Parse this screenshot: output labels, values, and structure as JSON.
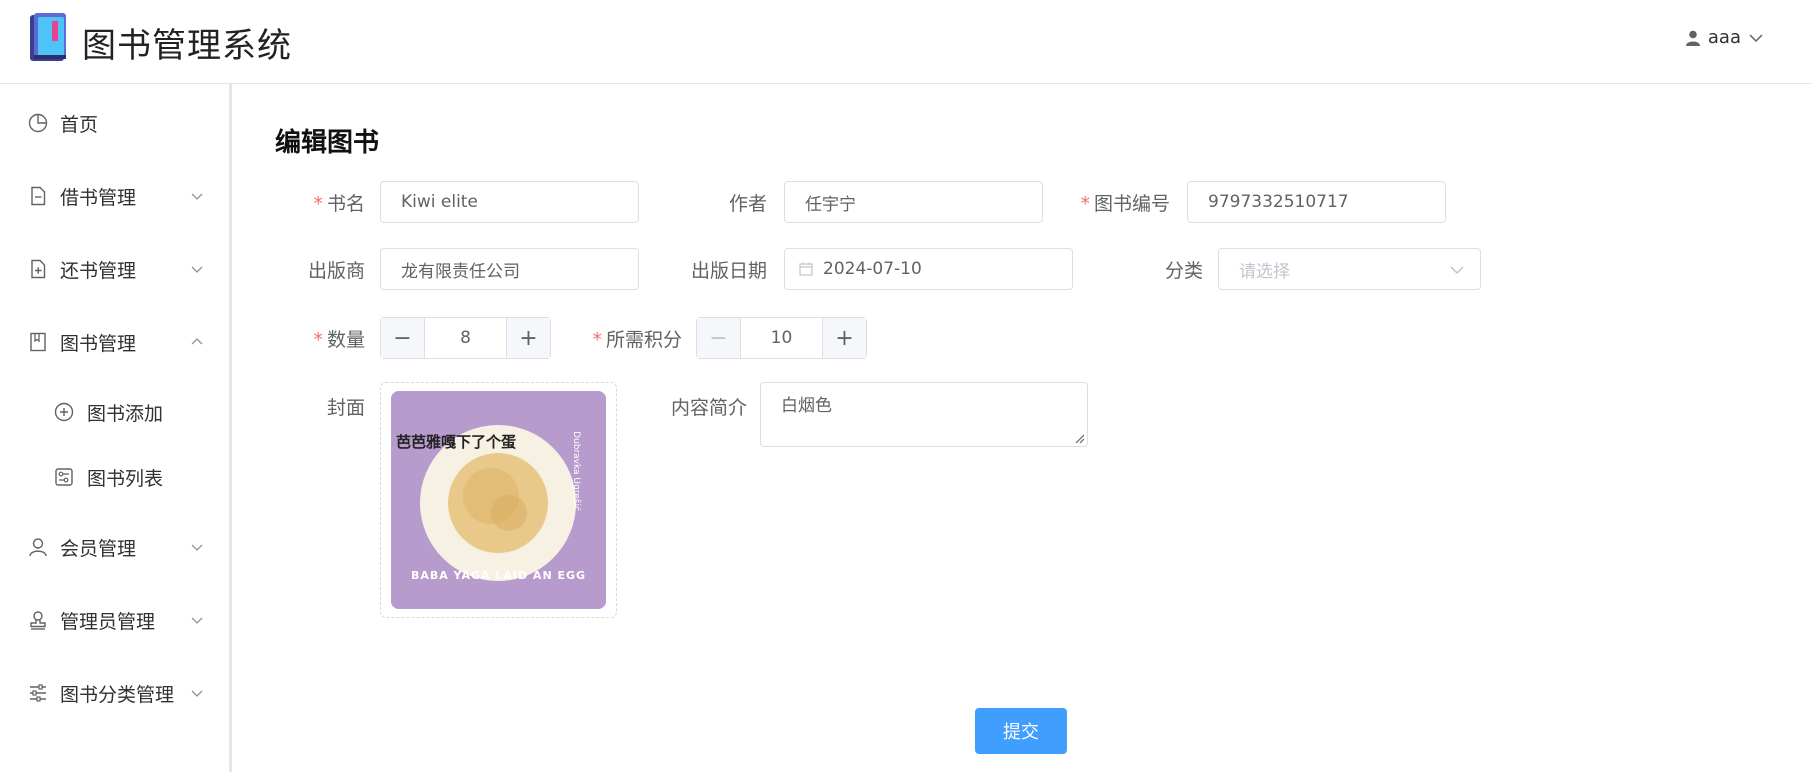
{
  "app": {
    "title": "图书管理系统"
  },
  "user": {
    "name": "aaa"
  },
  "sidebar": {
    "items": [
      {
        "label": "首页"
      },
      {
        "label": "借书管理"
      },
      {
        "label": "还书管理"
      },
      {
        "label": "图书管理"
      },
      {
        "label": "图书添加"
      },
      {
        "label": "图书列表"
      },
      {
        "label": "会员管理"
      },
      {
        "label": "管理员管理"
      },
      {
        "label": "图书分类管理"
      }
    ]
  },
  "form": {
    "title": "编辑图书",
    "name": {
      "label": "书名",
      "value": "Kiwi elite",
      "required": "*"
    },
    "author": {
      "label": "作者",
      "value": "任宇宁"
    },
    "isbn": {
      "label": "图书编号",
      "value": "9797332510717",
      "required": "*"
    },
    "publisher": {
      "label": "出版商",
      "value": "龙有限责任公司"
    },
    "pub_date": {
      "label": "出版日期",
      "value": "2024-07-10"
    },
    "category": {
      "label": "分类",
      "placeholder": "请选择"
    },
    "quantity": {
      "label": "数量",
      "value": "8",
      "required": "*"
    },
    "points": {
      "label": "所需积分",
      "value": "10",
      "required": "*"
    },
    "cover": {
      "label": "封面",
      "title_cn": "芭芭雅嘎下了个蛋",
      "author_en": "Dubravka Ugrešić",
      "title_en": "BABA YAGA LAID AN EGG"
    },
    "intro": {
      "label": "内容简介",
      "value": "白烟色"
    },
    "submit_label": "提交"
  },
  "colors": {
    "primary": "#409eff",
    "required": "#f56c6c",
    "cover_bg": "#b79bcd"
  }
}
